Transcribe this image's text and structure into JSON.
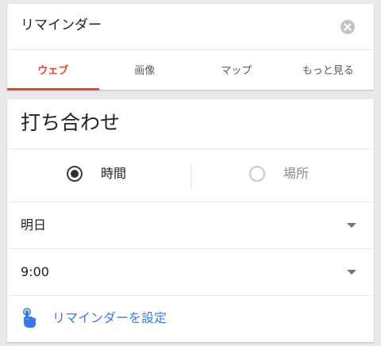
{
  "search": {
    "query": "リマインダー",
    "clear_icon": "close-circle-icon"
  },
  "tabs": [
    {
      "label": "ウェブ",
      "active": true
    },
    {
      "label": "画像",
      "active": false
    },
    {
      "label": "マップ",
      "active": false
    },
    {
      "label": "もっと見る",
      "active": false
    }
  ],
  "reminder": {
    "title": "打ち合わせ",
    "type_options": [
      {
        "label": "時間",
        "selected": true
      },
      {
        "label": "場所",
        "selected": false
      }
    ],
    "date": {
      "value": "明日"
    },
    "time": {
      "value": "9:00"
    },
    "set_button": {
      "label": "リマインダーを設定",
      "icon": "touch-hand-icon"
    }
  },
  "colors": {
    "accent_red": "#dd4b39",
    "link_blue": "#3b78e7",
    "background": "#e9e9e9"
  }
}
